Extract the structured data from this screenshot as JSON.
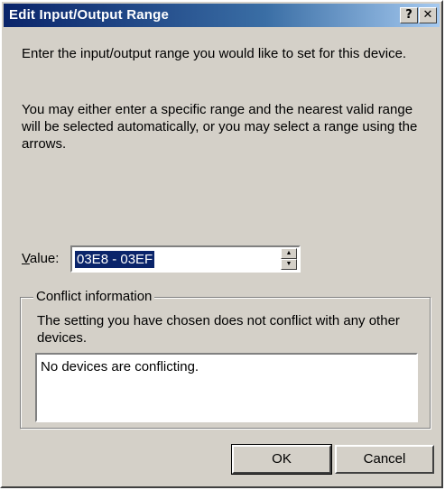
{
  "window": {
    "title": "Edit Input/Output Range",
    "help_label": "?",
    "close_label": "✕"
  },
  "instructions": {
    "line1": "Enter the input/output range you would like to set for this device.",
    "line2": "You may either enter a specific range and the nearest valid range will be selected automatically, or you may select a range using the arrows."
  },
  "value": {
    "label_mnemonic": "V",
    "label_rest": "alue:",
    "current": "03E8 - 03EF",
    "spin_up": "▲",
    "spin_down": "▼"
  },
  "conflict": {
    "group_label": "Conflict information",
    "message": "The setting you have chosen does not conflict with any other devices.",
    "list_text": "No devices are conflicting."
  },
  "buttons": {
    "ok": "OK",
    "cancel": "Cancel"
  }
}
